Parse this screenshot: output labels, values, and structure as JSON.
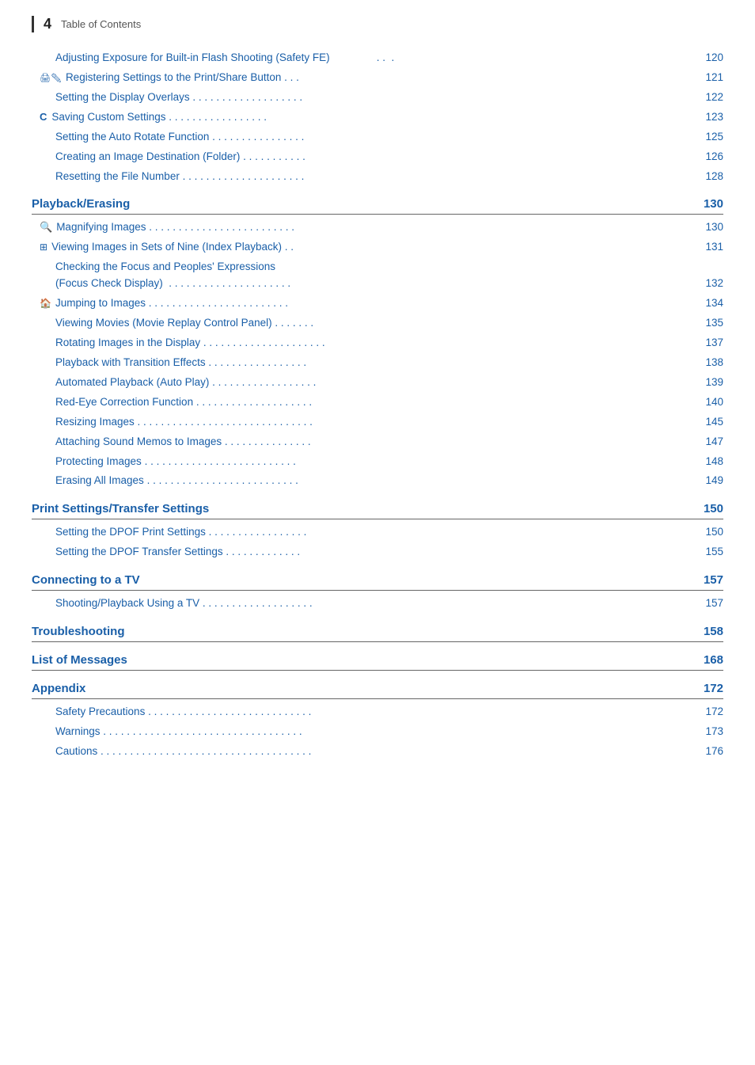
{
  "header": {
    "page_number": "4",
    "title": "Table of Contents"
  },
  "sections": [
    {
      "id": "top-entries",
      "entries": [
        {
          "icon": "📷✏",
          "icon_text": "🖨✏",
          "label": "Adjusting Exposure for Built-in Flash Shooting (Safety FE)",
          "dots": true,
          "page": "120"
        },
        {
          "icon": "🖨✏",
          "label": "Registering Settings to the Print/Share Button",
          "dots": true,
          "page": "121",
          "has_icon": true
        },
        {
          "label": "Setting the Display Overlays",
          "dots": true,
          "page": "122"
        },
        {
          "icon": "C",
          "label": "Saving Custom Settings",
          "dots": true,
          "page": "123",
          "has_icon": true
        },
        {
          "label": "Setting the Auto Rotate Function",
          "dots": true,
          "page": "125"
        },
        {
          "label": "Creating an Image Destination (Folder)",
          "dots": true,
          "page": "126"
        },
        {
          "label": "Resetting the File Number",
          "dots": true,
          "page": "128"
        }
      ]
    },
    {
      "id": "playback-erasing",
      "title": "Playback/Erasing",
      "title_page": "130",
      "entries": [
        {
          "icon": "🔍",
          "label": "Magnifying Images",
          "dots": true,
          "page": "130",
          "has_icon": true
        },
        {
          "icon": "⊞",
          "label": "Viewing Images in Sets of Nine (Index Playback)",
          "dots": true,
          "page": "131",
          "has_icon": true
        },
        {
          "multiline": true,
          "line1": "Checking the Focus and Peoples' Expressions",
          "line2": "(Focus Check Display)",
          "dots": true,
          "page": "132"
        },
        {
          "icon": "🏠",
          "label": "Jumping to Images",
          "dots": true,
          "page": "134",
          "has_icon": true
        },
        {
          "label": "Viewing Movies (Movie Replay Control Panel)",
          "dots": true,
          "page": "135"
        },
        {
          "label": "Rotating Images in the Display",
          "dots": true,
          "page": "137"
        },
        {
          "label": "Playback with Transition Effects",
          "dots": true,
          "page": "138"
        },
        {
          "label": "Automated Playback (Auto Play)",
          "dots": true,
          "page": "139"
        },
        {
          "label": "Red-Eye Correction Function",
          "dots": true,
          "page": "140"
        },
        {
          "label": "Resizing Images",
          "dots": true,
          "page": "145"
        },
        {
          "label": "Attaching Sound Memos to Images",
          "dots": true,
          "page": "147"
        },
        {
          "label": "Protecting Images",
          "dots": true,
          "page": "148"
        },
        {
          "label": "Erasing All Images",
          "dots": true,
          "page": "149"
        }
      ]
    },
    {
      "id": "print-settings",
      "title": "Print Settings/Transfer Settings",
      "title_page": "150",
      "entries": [
        {
          "label": "Setting the DPOF Print Settings",
          "dots": true,
          "page": "150"
        },
        {
          "label": "Setting the DPOF Transfer Settings",
          "dots": true,
          "page": "155"
        }
      ]
    },
    {
      "id": "connecting-tv",
      "title": "Connecting to a TV",
      "title_page": "157",
      "entries": [
        {
          "label": "Shooting/Playback Using a TV",
          "dots": true,
          "page": "157"
        }
      ]
    },
    {
      "id": "troubleshooting",
      "title": "Troubleshooting",
      "title_page": "158",
      "entries": []
    },
    {
      "id": "list-messages",
      "title": "List of Messages",
      "title_page": "168",
      "entries": []
    },
    {
      "id": "appendix",
      "title": "Appendix",
      "title_page": "172",
      "entries": [
        {
          "label": "Safety Precautions",
          "dots": true,
          "page": "172"
        },
        {
          "label": "Warnings",
          "dots": true,
          "page": "173"
        },
        {
          "label": "Cautions",
          "dots": true,
          "page": "176"
        }
      ]
    }
  ]
}
